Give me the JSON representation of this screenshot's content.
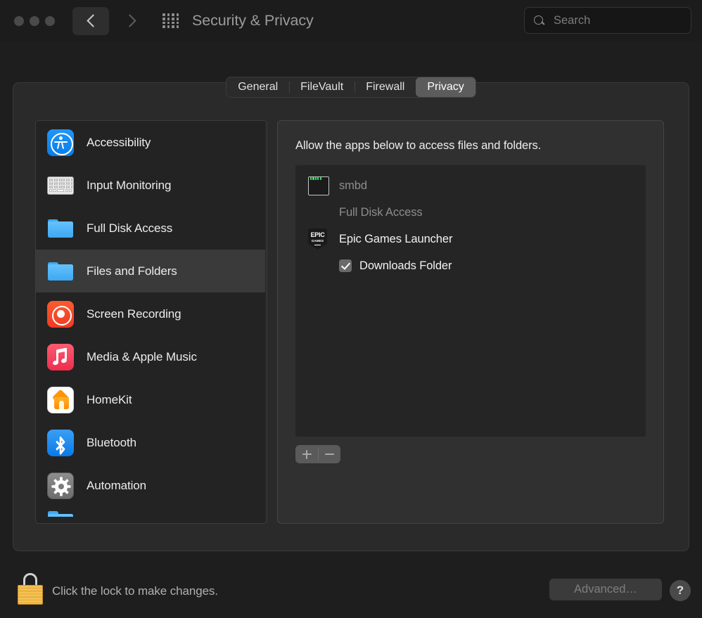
{
  "window": {
    "title": "Security & Privacy",
    "traffic_lights": [
      "close",
      "minimize",
      "zoom"
    ],
    "nav_back": "back-chevron",
    "nav_forward": "forward-chevron",
    "grid_icon": "grid-icon"
  },
  "search": {
    "placeholder": "Search",
    "icon": "search-icon"
  },
  "tabs": [
    {
      "label": "General",
      "selected": false
    },
    {
      "label": "FileVault",
      "selected": false
    },
    {
      "label": "Firewall",
      "selected": false
    },
    {
      "label": "Privacy",
      "selected": true
    }
  ],
  "sidebar": {
    "items": [
      {
        "label": "Accessibility",
        "icon": "accessibility-icon",
        "selected": false
      },
      {
        "label": "Input Monitoring",
        "icon": "keyboard-icon",
        "selected": false
      },
      {
        "label": "Full Disk Access",
        "icon": "folder-icon",
        "selected": false
      },
      {
        "label": "Files and Folders",
        "icon": "folder-icon",
        "selected": true
      },
      {
        "label": "Screen Recording",
        "icon": "record-icon",
        "selected": false
      },
      {
        "label": "Media & Apple Music",
        "icon": "music-note-icon",
        "selected": false
      },
      {
        "label": "HomeKit",
        "icon": "home-icon",
        "selected": false
      },
      {
        "label": "Bluetooth",
        "icon": "bluetooth-icon",
        "selected": false
      },
      {
        "label": "Automation",
        "icon": "gear-icon",
        "selected": false
      }
    ]
  },
  "content": {
    "description": "Allow the apps below to access files and folders.",
    "rows": [
      {
        "type": "app",
        "name": "smbd",
        "icon": "terminal-icon",
        "dimmed": true
      },
      {
        "type": "sub",
        "name": "Full Disk Access",
        "checkbox": false,
        "dimmed": true
      },
      {
        "type": "app",
        "name": "Epic Games Launcher",
        "icon": "epic-games-icon",
        "dimmed": false
      },
      {
        "type": "sub",
        "name": "Downloads Folder",
        "checkbox": true,
        "checked": true,
        "dimmed": false
      }
    ],
    "epic_logo": {
      "top": "EPIC",
      "bottom": "GAMES"
    },
    "add_button": "+",
    "remove_button": "−"
  },
  "footer": {
    "lock_icon": "lock-closed-icon",
    "lock_text": "Click the lock to make changes.",
    "advanced_label": "Advanced…",
    "help_label": "?"
  },
  "colors": {
    "window_bg": "#1e1e1e",
    "panel_bg": "#2a2a2a",
    "sidebar_bg": "#232323",
    "content_bg": "#303030",
    "list_bg": "#252525",
    "selected_row": "#3a3a3a",
    "tab_selected": "#5c5c5c",
    "accent_blue": "#0a7de8",
    "lock_gold": "#f5c152"
  }
}
